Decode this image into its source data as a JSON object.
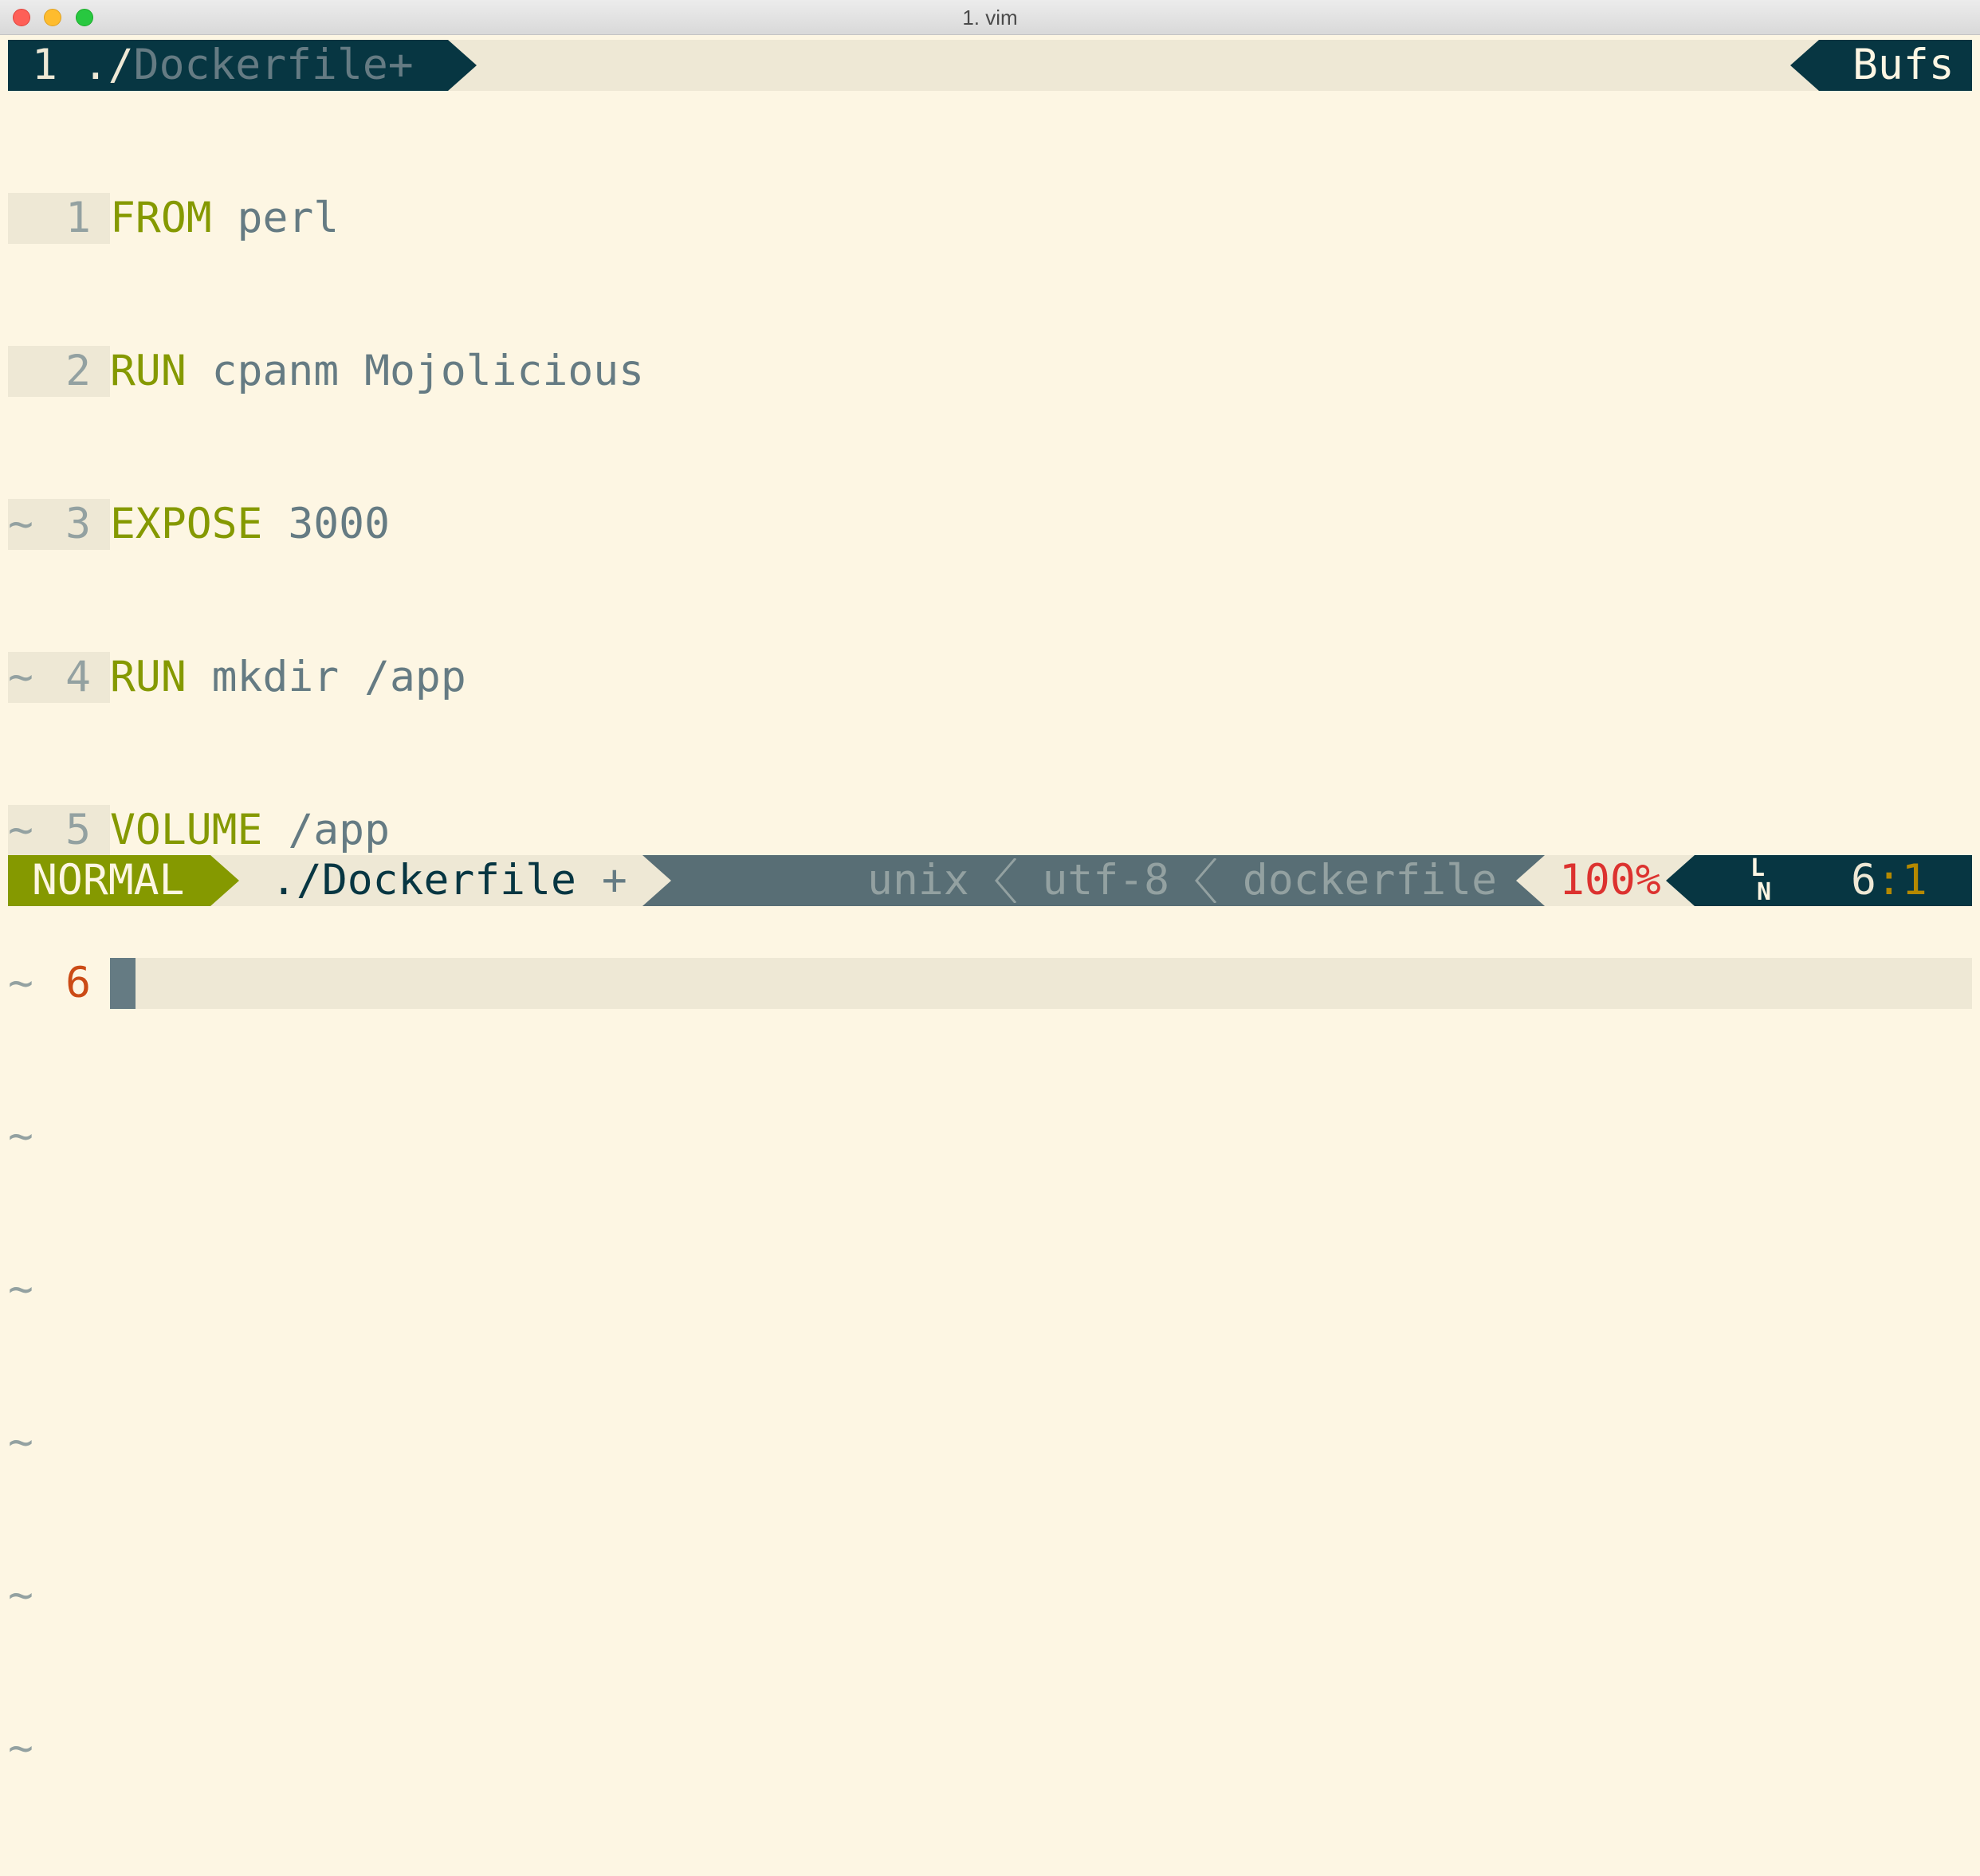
{
  "window": {
    "title": "1. vim"
  },
  "tabline": {
    "active_tab": {
      "number": "1",
      "prefix": "./",
      "name": "Dockerfile+"
    },
    "buffers_label": "Bufs"
  },
  "editor": {
    "lines": [
      {
        "number": "1",
        "keyword": "FROM",
        "rest": " perl"
      },
      {
        "number": "2",
        "keyword": "RUN",
        "rest": " cpanm Mojolicious"
      },
      {
        "number": "3",
        "keyword": "EXPOSE",
        "rest": " 3000"
      },
      {
        "number": "4",
        "keyword": "RUN",
        "rest": " mkdir /app"
      },
      {
        "number": "5",
        "keyword": "VOLUME",
        "rest": " /app"
      },
      {
        "number": "6",
        "keyword": "",
        "rest": ""
      }
    ],
    "empty_marker": "~"
  },
  "statusline": {
    "mode": "NORMAL",
    "file": "./Dockerfile",
    "modified_flag": "+",
    "fileformat": "unix",
    "encoding": "utf-8",
    "filetype": "dockerfile",
    "percent": "100%",
    "line_icon_top": "L",
    "line_icon_bottom": "N",
    "cursor_line": "6",
    "cursor_col": ":1"
  },
  "colors": {
    "background": "#fdf6e3",
    "gutter": "#eee8d5",
    "keyword": "#859900",
    "text": "#657b83",
    "dark": "#073642",
    "percent": "#dc322f",
    "column": "#b58900",
    "current_line_number": "#cb4b16"
  }
}
